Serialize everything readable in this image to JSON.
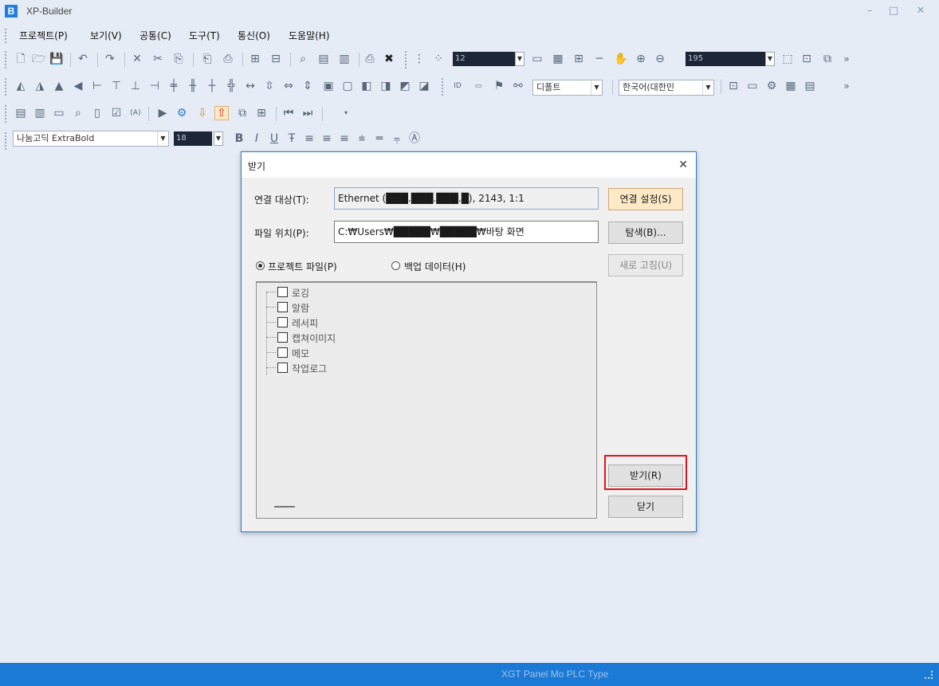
{
  "window": {
    "title": "XP-Builder",
    "logo_letter": "B",
    "controls": {
      "minimize": "–",
      "maximize": "□",
      "close": "✕"
    }
  },
  "menu": [
    {
      "label": "프로젝트(P)"
    },
    {
      "label": "보기(V)"
    },
    {
      "label": "공통(C)"
    },
    {
      "label": "도구(T)"
    },
    {
      "label": "통신(O)"
    },
    {
      "label": "도움말(H)"
    }
  ],
  "toolbar": {
    "line_width_value": "12",
    "zoom_value": "195",
    "font_face_combo": "디폴트",
    "language_combo": "한국어(대한민",
    "font_name": "나눔고딕 ExtraBold",
    "font_size": "18",
    "more_glyph": "»"
  },
  "dialog": {
    "title": "받기",
    "connection_label": "연결 대상(T):",
    "connection_value": "Ethernet (███.███.███.█), 2143, 1:1",
    "connection_settings_button": "연결 설정(S)",
    "file_location_label": "파일 위치(P):",
    "file_location_value": "C:₩Users₩█████₩█████₩바탕 화면",
    "browse_button": "탐색(B)...",
    "refresh_button": "새로 고침(U)",
    "radio_project": "프로젝트 파일(P)",
    "radio_backup": "백업 데이터(H)",
    "selected_radio": "프로젝트 파일(P)",
    "tree_items": [
      {
        "label": "로깅",
        "checked": false
      },
      {
        "label": "알람",
        "checked": false
      },
      {
        "label": "레서피",
        "checked": false
      },
      {
        "label": "캡쳐이미지",
        "checked": false
      },
      {
        "label": "메모",
        "checked": false
      },
      {
        "label": "작업로그",
        "checked": false
      }
    ],
    "receive_button": "받기(R)",
    "close_button": "닫기"
  },
  "statusbar": {
    "text": "XGT Panel Mo  PLC Type"
  },
  "colors": {
    "accent": "#1b7ad6",
    "highlight_border": "#e0141c",
    "primary_button": "#fde9c6"
  }
}
